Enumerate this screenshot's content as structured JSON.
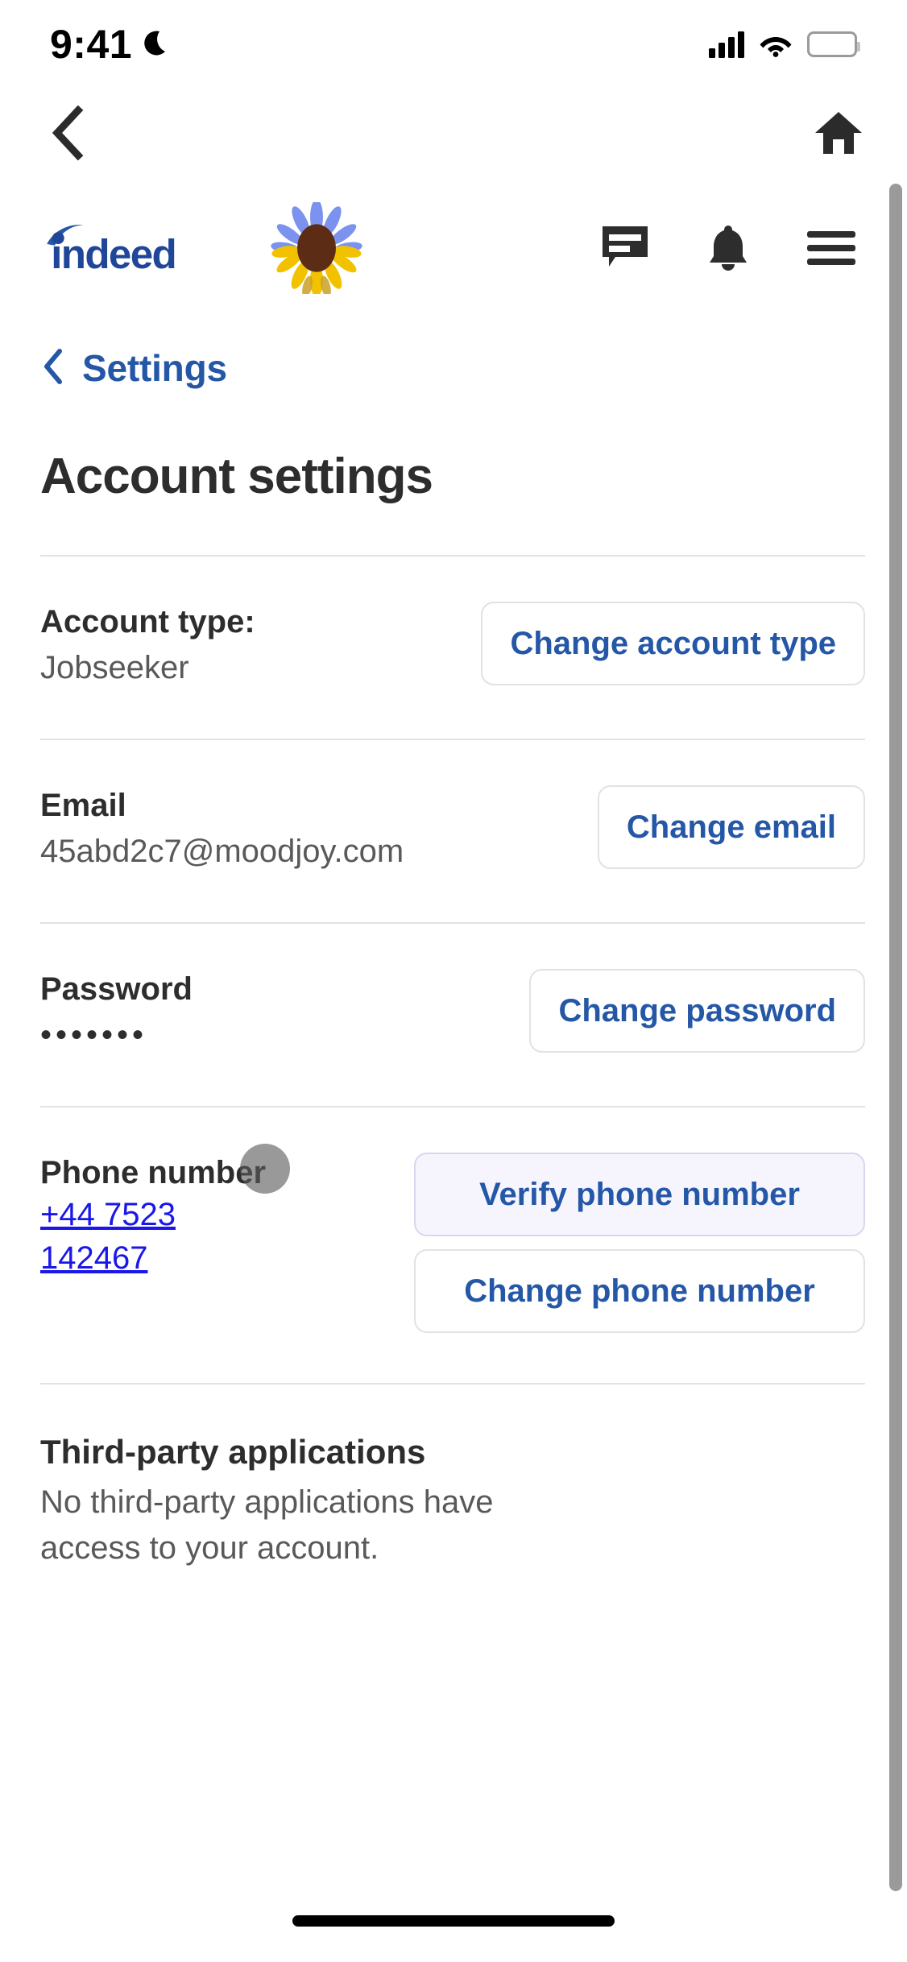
{
  "status_bar": {
    "time": "9:41",
    "dnd_icon": "moon-icon",
    "signal_icon": "cellular-signal-icon",
    "wifi_icon": "wifi-icon",
    "battery_icon": "battery-full-icon"
  },
  "browser_nav": {
    "back_icon": "chevron-left-icon",
    "home_icon": "home-icon"
  },
  "site_header": {
    "logo_text": "indeed",
    "logo_color": "#2557a7",
    "sunflower_icon": "sunflower-icon",
    "messages_icon": "message-bubble-icon",
    "notifications_icon": "bell-icon",
    "menu_icon": "hamburger-menu-icon"
  },
  "breadcrumb": {
    "back_icon": "chevron-left-icon",
    "label": "Settings",
    "color": "#2557a7"
  },
  "page": {
    "title": "Account settings"
  },
  "settings_rows": [
    {
      "label": "Account type:",
      "value": "Jobseeker",
      "buttons": [
        {
          "label": "Change account type",
          "highlighted": false
        }
      ]
    },
    {
      "label": "Email",
      "value": "45abd2c7@moodjoy.com",
      "buttons": [
        {
          "label": "Change email",
          "highlighted": false
        }
      ]
    },
    {
      "label": "Password",
      "value": "•••••••",
      "buttons": [
        {
          "label": "Change password",
          "highlighted": false
        }
      ]
    },
    {
      "label": "Phone number",
      "value": "+44 7523 142467",
      "buttons": [
        {
          "label": "Verify phone number",
          "highlighted": true
        },
        {
          "label": "Change phone number",
          "highlighted": false
        }
      ]
    }
  ],
  "third_party": {
    "title": "Third-party applications",
    "description": "No third-party applications have access to your account."
  },
  "colors": {
    "link_blue": "#2557a7",
    "phone_link_blue": "#1a17e8",
    "text_dark": "#2d2d2d",
    "text_muted": "#595959",
    "border": "#e4e2e0",
    "highlight_bg": "#f6f5fd"
  }
}
